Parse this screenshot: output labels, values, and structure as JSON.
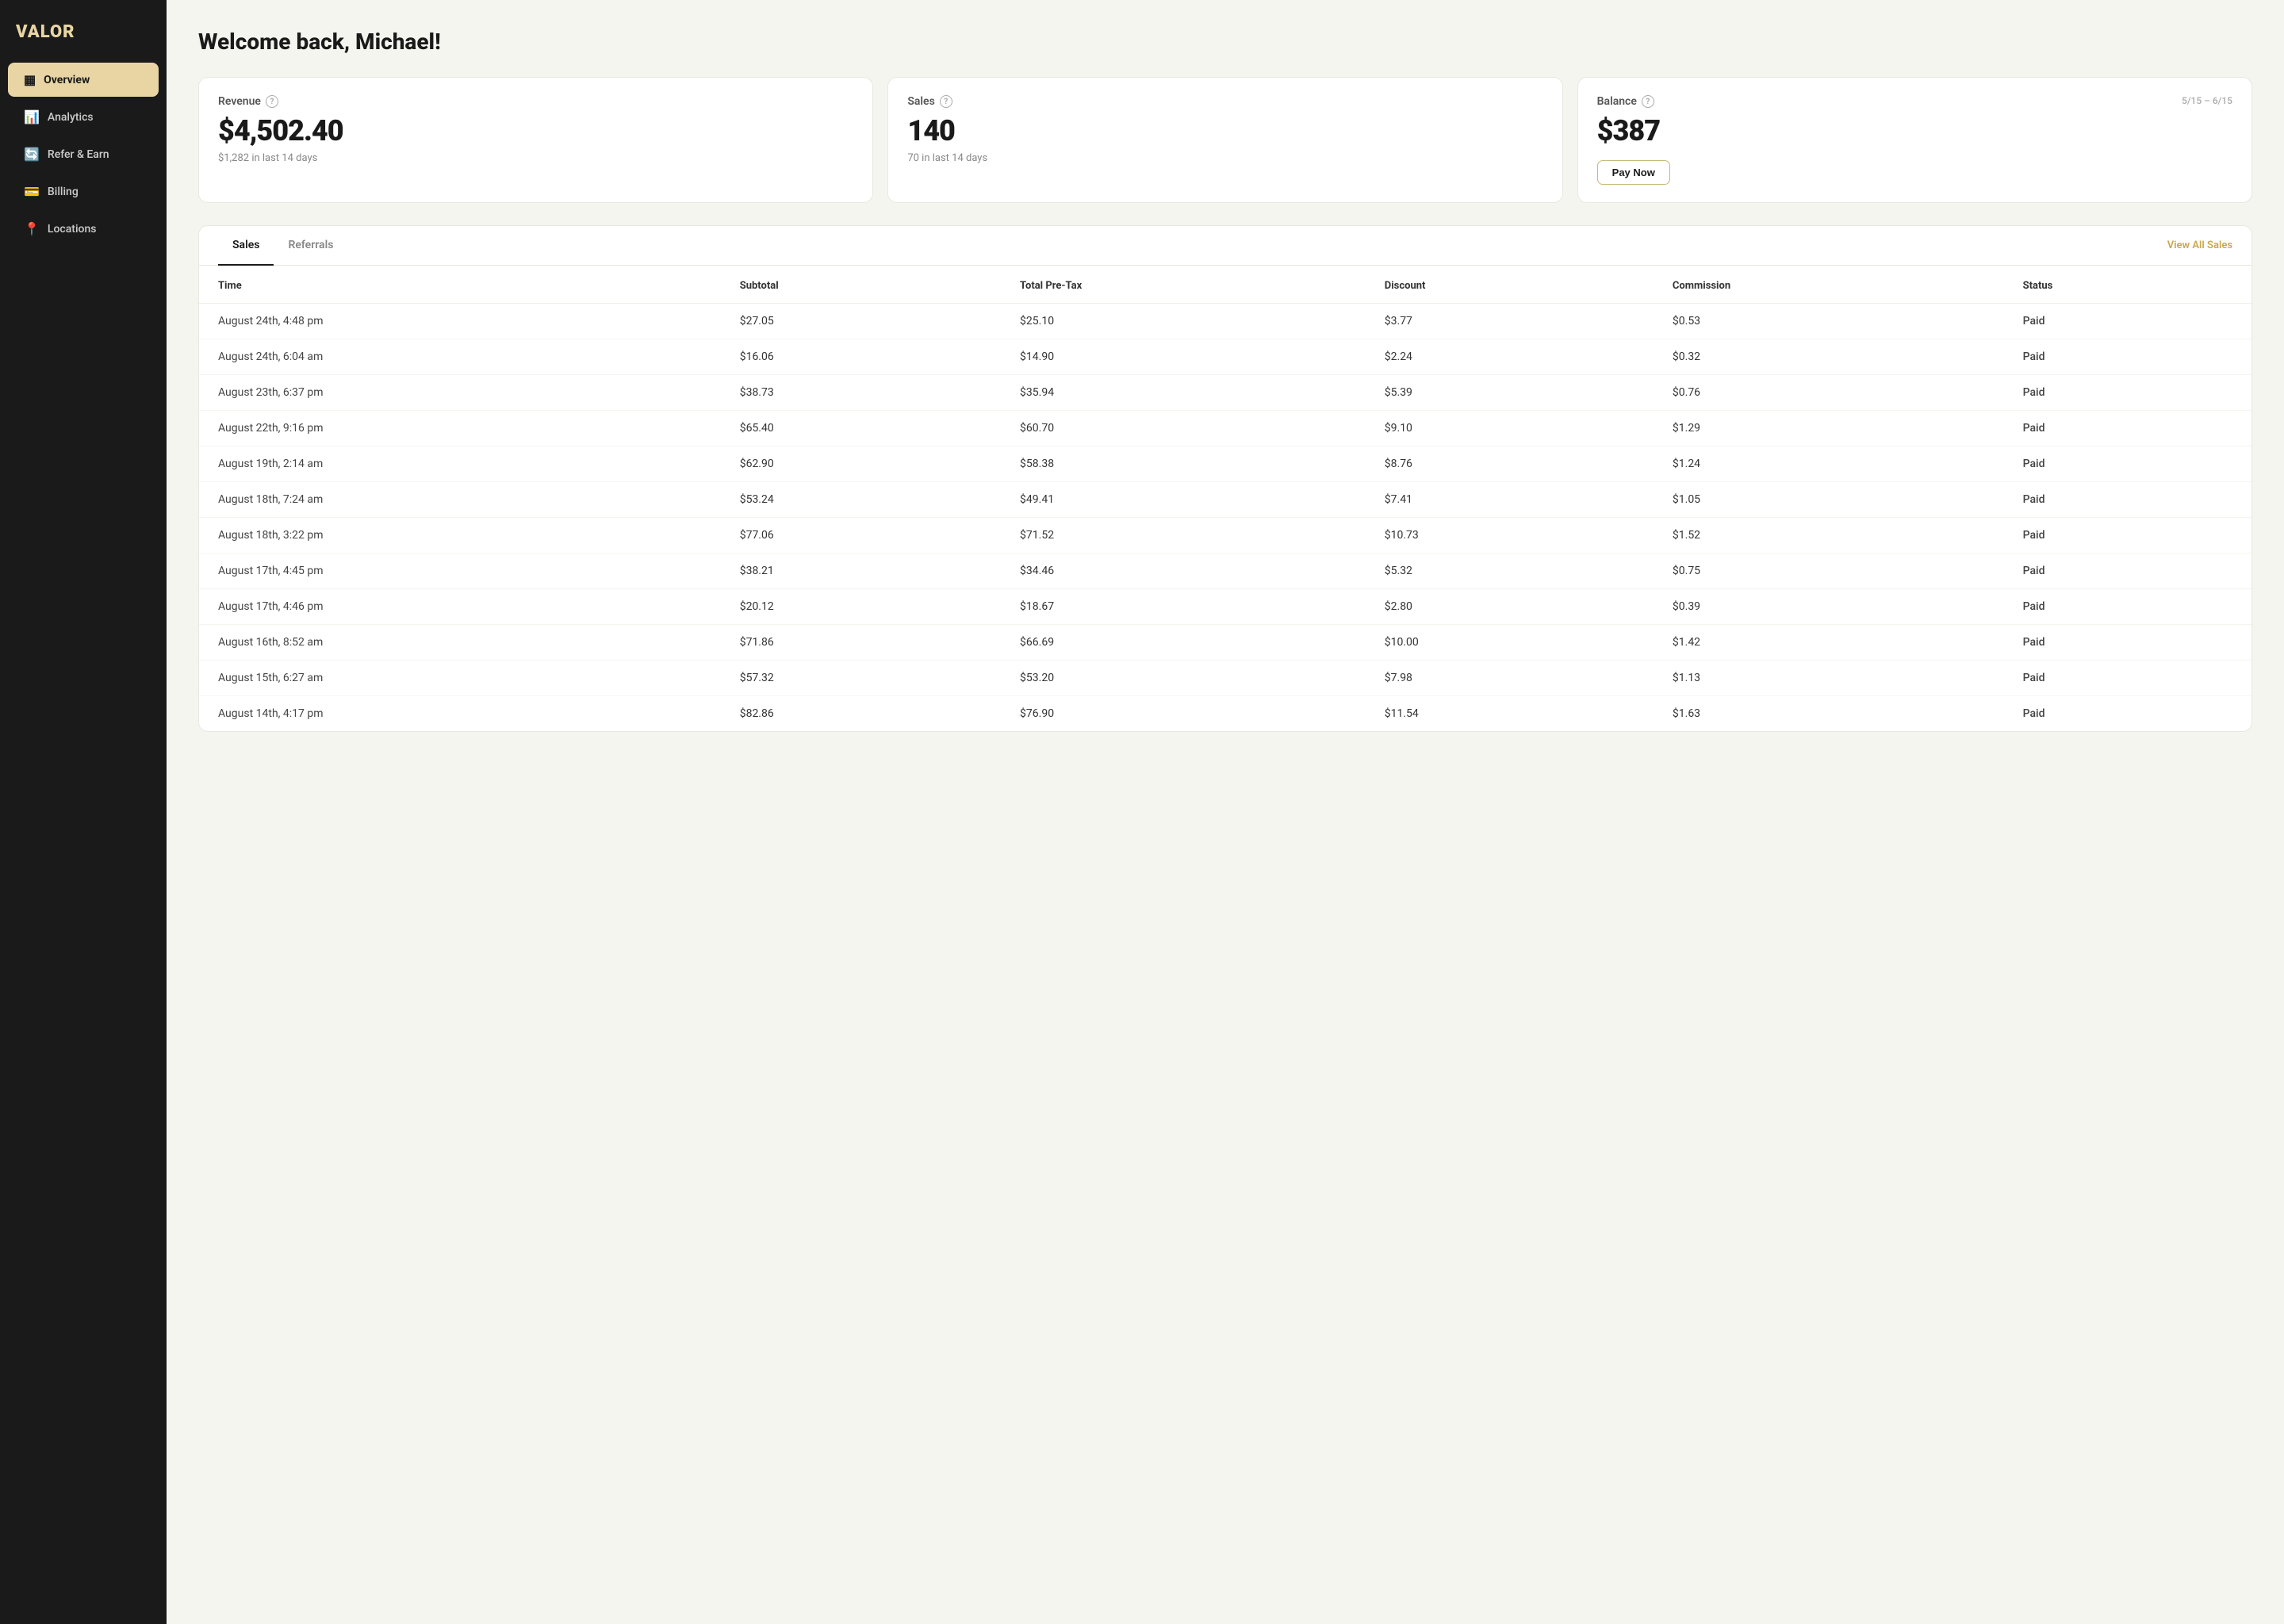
{
  "logo": {
    "text": "VALOR"
  },
  "sidebar": {
    "items": [
      {
        "id": "overview",
        "label": "Overview",
        "icon": "▦",
        "active": true
      },
      {
        "id": "analytics",
        "label": "Analytics",
        "icon": "⬧",
        "active": false
      },
      {
        "id": "refer-earn",
        "label": "Refer & Earn",
        "icon": "⟳",
        "active": false
      },
      {
        "id": "billing",
        "label": "Billing",
        "icon": "▭",
        "active": false
      },
      {
        "id": "locations",
        "label": "Locations",
        "icon": "⊞",
        "active": false
      }
    ]
  },
  "page": {
    "title": "Welcome back, Michael!"
  },
  "cards": [
    {
      "id": "revenue",
      "label": "Revenue",
      "value": "$4,502.40",
      "sub": "$1,282 in last 14 days",
      "date": null,
      "show_pay": false
    },
    {
      "id": "sales",
      "label": "Sales",
      "value": "140",
      "sub": "70 in last 14 days",
      "date": null,
      "show_pay": false
    },
    {
      "id": "balance",
      "label": "Balance",
      "value": "$387",
      "sub": null,
      "date": "5/15 – 6/15",
      "show_pay": true,
      "pay_label": "Pay Now"
    }
  ],
  "tabs": [
    {
      "id": "sales",
      "label": "Sales",
      "active": true
    },
    {
      "id": "referrals",
      "label": "Referrals",
      "active": false
    }
  ],
  "view_all_label": "View All Sales",
  "table": {
    "columns": [
      "Time",
      "Subtotal",
      "Total Pre-Tax",
      "Discount",
      "Commission",
      "Status"
    ],
    "rows": [
      [
        "August 24th, 4:48 pm",
        "$27.05",
        "$25.10",
        "$3.77",
        "$0.53",
        "Paid"
      ],
      [
        "August 24th, 6:04 am",
        "$16.06",
        "$14.90",
        "$2.24",
        "$0.32",
        "Paid"
      ],
      [
        "August 23th, 6:37 pm",
        "$38.73",
        "$35.94",
        "$5.39",
        "$0.76",
        "Paid"
      ],
      [
        "August 22th, 9:16 pm",
        "$65.40",
        "$60.70",
        "$9.10",
        "$1.29",
        "Paid"
      ],
      [
        "August 19th, 2:14 am",
        "$62.90",
        "$58.38",
        "$8.76",
        "$1.24",
        "Paid"
      ],
      [
        "August 18th, 7:24 am",
        "$53.24",
        "$49.41",
        "$7.41",
        "$1.05",
        "Paid"
      ],
      [
        "August 18th, 3:22 pm",
        "$77.06",
        "$71.52",
        "$10.73",
        "$1.52",
        "Paid"
      ],
      [
        "August 17th, 4:45 pm",
        "$38.21",
        "$34.46",
        "$5.32",
        "$0.75",
        "Paid"
      ],
      [
        "August 17th, 4:46 pm",
        "$20.12",
        "$18.67",
        "$2.80",
        "$0.39",
        "Paid"
      ],
      [
        "August 16th, 8:52 am",
        "$71.86",
        "$66.69",
        "$10.00",
        "$1.42",
        "Paid"
      ],
      [
        "August 15th, 6:27 am",
        "$57.32",
        "$53.20",
        "$7.98",
        "$1.13",
        "Paid"
      ],
      [
        "August 14th, 4:17 pm",
        "$82.86",
        "$76.90",
        "$11.54",
        "$1.63",
        "Paid"
      ]
    ]
  }
}
